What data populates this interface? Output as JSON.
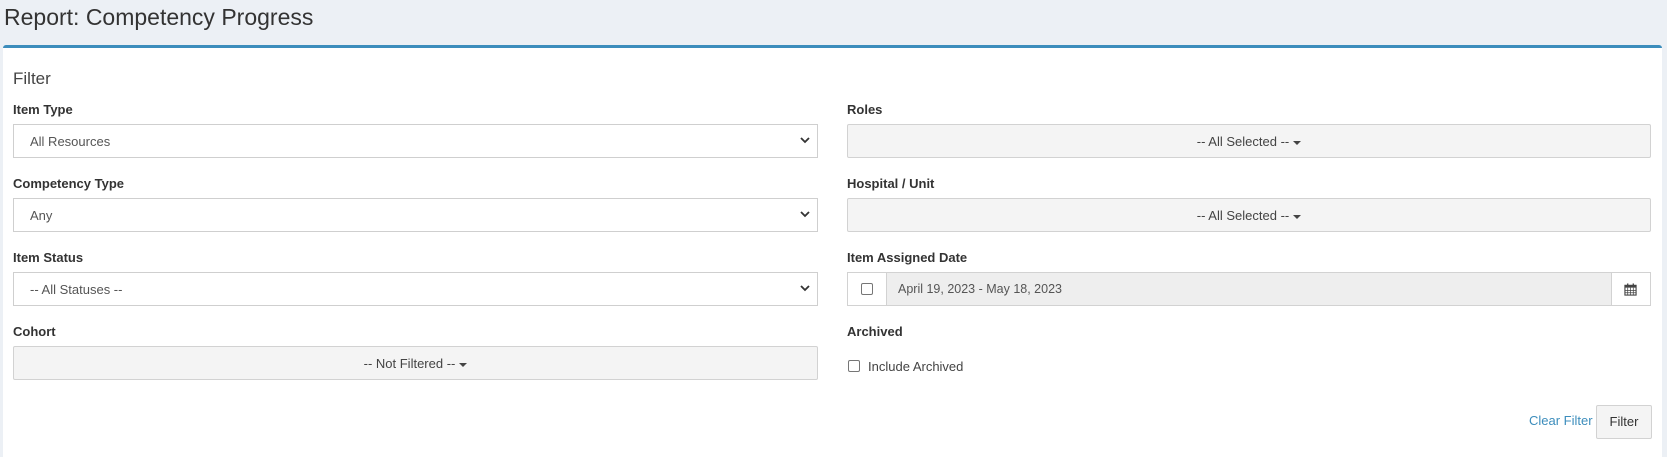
{
  "page": {
    "title": "Report: Competency Progress"
  },
  "filter": {
    "heading": "Filter",
    "item_type": {
      "label": "Item Type",
      "value": "All Resources"
    },
    "competency_type": {
      "label": "Competency Type",
      "value": "Any"
    },
    "item_status": {
      "label": "Item Status",
      "value": "-- All Statuses --"
    },
    "cohort": {
      "label": "Cohort",
      "value": "-- Not Filtered --"
    },
    "roles": {
      "label": "Roles",
      "value": "-- All Selected --"
    },
    "hospital_unit": {
      "label": "Hospital / Unit",
      "value": "-- All Selected --"
    },
    "item_assigned_date": {
      "label": "Item Assigned Date",
      "value": "April 19, 2023 - May 18, 2023",
      "enabled": false
    },
    "archived": {
      "label": "Archived",
      "checkbox_label": "Include Archived",
      "checked": false
    },
    "clear_label": "Clear Filter",
    "submit_label": "Filter"
  },
  "colors": {
    "accent": "#3c8dbc",
    "background": "#ecf0f5"
  },
  "icons": {
    "select_arrow": "chevron-down-icon",
    "multiselect_caret": "caret-down-icon",
    "date": "calendar-icon"
  }
}
